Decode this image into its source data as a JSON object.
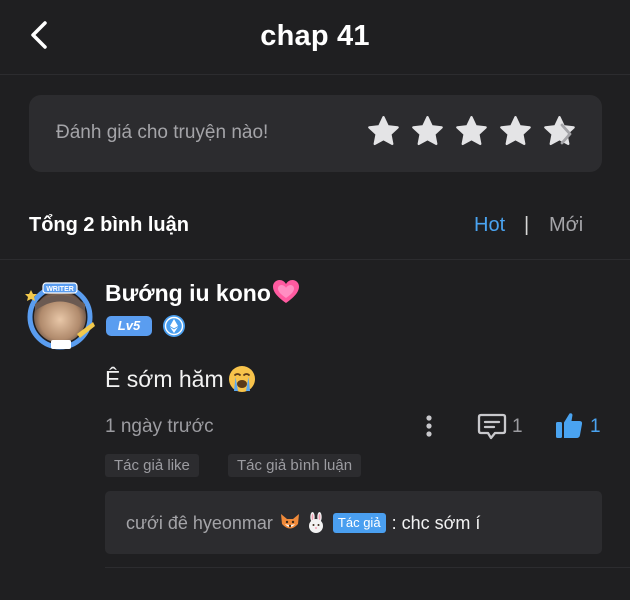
{
  "header": {
    "title": "chap 41"
  },
  "rating": {
    "prompt": "Đánh giá cho truyện nào!",
    "star_count": 5
  },
  "comments_bar": {
    "total_label": "Tổng 2 bình luận",
    "sort_hot": "Hot",
    "separator": "|",
    "sort_new": "Mới"
  },
  "comment": {
    "username": "Bướng iu kono",
    "level": "Lv5",
    "text": "Ê sớm hăm",
    "time": "1 ngày trước",
    "reply_count": "1",
    "like_count": "1",
    "tags": [
      "Tác giả like",
      "Tác giả bình luận"
    ],
    "reply": {
      "user": "cưới đê hyeonmar",
      "author_tag": "Tác giả",
      "text": ": chc sớm í"
    }
  },
  "colors": {
    "accent": "#4aa3f0",
    "background": "#1f1f21",
    "card": "#2c2c2f"
  }
}
